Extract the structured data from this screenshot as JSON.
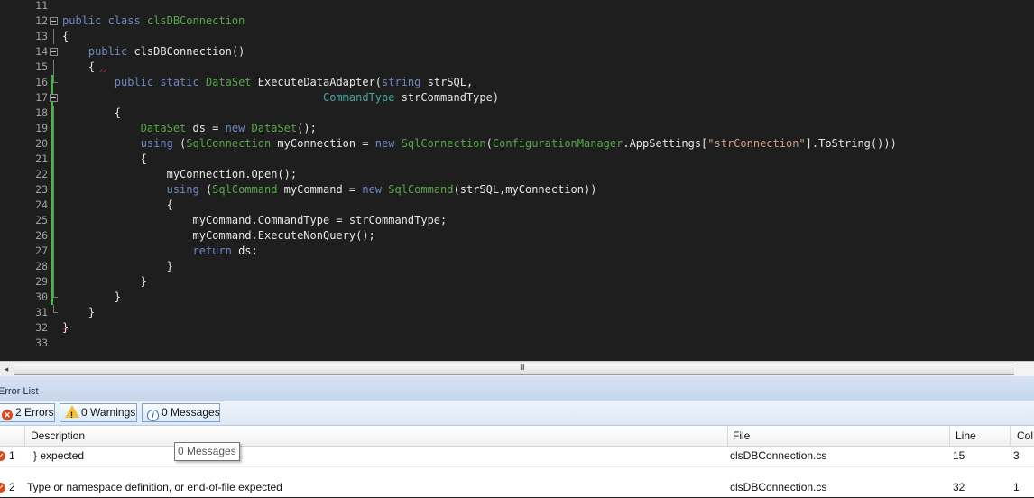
{
  "editor": {
    "lines": [
      {
        "n": "11",
        "segs": []
      },
      {
        "n": "12",
        "segs": [
          {
            "t": "public class ",
            "c": "kw"
          },
          {
            "t": "clsDBConnection",
            "c": "ty"
          }
        ]
      },
      {
        "n": "13",
        "segs": [
          {
            "t": "{",
            "c": ""
          }
        ]
      },
      {
        "n": "14",
        "segs": [
          {
            "t": "    public ",
            "c": "kw"
          },
          {
            "t": "clsDBConnection()",
            "c": ""
          }
        ]
      },
      {
        "n": "15",
        "segs": [
          {
            "t": "    {",
            "c": ""
          }
        ]
      },
      {
        "n": "16",
        "segs": [
          {
            "t": "        public static ",
            "c": "kw"
          },
          {
            "t": "DataSet",
            "c": "ty"
          },
          {
            "t": " ExecuteDataAdapter(",
            "c": ""
          },
          {
            "t": "string",
            "c": "kw"
          },
          {
            "t": " strSQL,",
            "c": ""
          }
        ]
      },
      {
        "n": "17",
        "segs": [
          {
            "t": "                                        ",
            "c": ""
          },
          {
            "t": "CommandType",
            "c": "tyb"
          },
          {
            "t": " strCommandType)",
            "c": ""
          }
        ]
      },
      {
        "n": "18",
        "segs": [
          {
            "t": "        {",
            "c": ""
          }
        ]
      },
      {
        "n": "19",
        "segs": [
          {
            "t": "            ",
            "c": ""
          },
          {
            "t": "DataSet",
            "c": "ty"
          },
          {
            "t": " ds = ",
            "c": ""
          },
          {
            "t": "new ",
            "c": "kw"
          },
          {
            "t": "DataSet",
            "c": "ty"
          },
          {
            "t": "();",
            "c": ""
          }
        ]
      },
      {
        "n": "20",
        "segs": [
          {
            "t": "            ",
            "c": ""
          },
          {
            "t": "using",
            "c": "kw"
          },
          {
            "t": " (",
            "c": ""
          },
          {
            "t": "SqlConnection",
            "c": "ty"
          },
          {
            "t": " myConnection = ",
            "c": ""
          },
          {
            "t": "new ",
            "c": "kw"
          },
          {
            "t": "SqlConnection",
            "c": "ty"
          },
          {
            "t": "(",
            "c": ""
          },
          {
            "t": "ConfigurationManager",
            "c": "ty"
          },
          {
            "t": ".AppSettings[",
            "c": ""
          },
          {
            "t": "\"strConnection\"",
            "c": "str"
          },
          {
            "t": "].ToString()))",
            "c": ""
          }
        ]
      },
      {
        "n": "21",
        "segs": [
          {
            "t": "            {",
            "c": ""
          }
        ]
      },
      {
        "n": "22",
        "segs": [
          {
            "t": "                myConnection.Open();",
            "c": ""
          }
        ]
      },
      {
        "n": "23",
        "segs": [
          {
            "t": "                ",
            "c": ""
          },
          {
            "t": "using",
            "c": "kw"
          },
          {
            "t": " (",
            "c": ""
          },
          {
            "t": "SqlCommand",
            "c": "ty"
          },
          {
            "t": " myCommand = ",
            "c": ""
          },
          {
            "t": "new ",
            "c": "kw"
          },
          {
            "t": "SqlCommand",
            "c": "ty"
          },
          {
            "t": "(strSQL,myConnection))",
            "c": ""
          }
        ]
      },
      {
        "n": "24",
        "segs": [
          {
            "t": "                {",
            "c": ""
          }
        ]
      },
      {
        "n": "25",
        "segs": [
          {
            "t": "                    myCommand.CommandType = strCommandType;",
            "c": ""
          }
        ]
      },
      {
        "n": "26",
        "segs": [
          {
            "t": "                    myCommand.ExecuteNonQuery();",
            "c": ""
          }
        ]
      },
      {
        "n": "27",
        "segs": [
          {
            "t": "                    ",
            "c": ""
          },
          {
            "t": "return",
            "c": "kw"
          },
          {
            "t": " ds;",
            "c": ""
          }
        ]
      },
      {
        "n": "28",
        "segs": [
          {
            "t": "                }",
            "c": ""
          }
        ]
      },
      {
        "n": "29",
        "segs": [
          {
            "t": "            }",
            "c": ""
          }
        ]
      },
      {
        "n": "30",
        "segs": [
          {
            "t": "        }",
            "c": ""
          }
        ]
      },
      {
        "n": "31",
        "segs": [
          {
            "t": "    }",
            "c": ""
          }
        ]
      },
      {
        "n": "32",
        "segs": [
          {
            "t": "}",
            "c": ""
          }
        ]
      },
      {
        "n": "33",
        "segs": []
      }
    ]
  },
  "scrollbar": {
    "left_arrow": "◂",
    "grip": "III"
  },
  "error_list": {
    "title": "Error List",
    "filters": {
      "errors": "2 Errors",
      "warnings": "0 Warnings",
      "messages": "0 Messages"
    },
    "columns": [
      "Description",
      "File",
      "Line",
      "Col"
    ],
    "rows": [
      {
        "num": "1",
        "description": "} expected",
        "file": "clsDBConnection.cs",
        "line": "15",
        "col": "3"
      },
      {
        "num": "2",
        "description": "Type or namespace definition, or end-of-file expected",
        "file": "clsDBConnection.cs",
        "line": "32",
        "col": "1"
      }
    ],
    "tooltip": "0 Messages"
  },
  "colors": {
    "editor_bg": "#1e1e1e",
    "keyword": "#6f86c4",
    "type": "#57a64a",
    "string": "#d69d85",
    "error": "#d84a20"
  }
}
